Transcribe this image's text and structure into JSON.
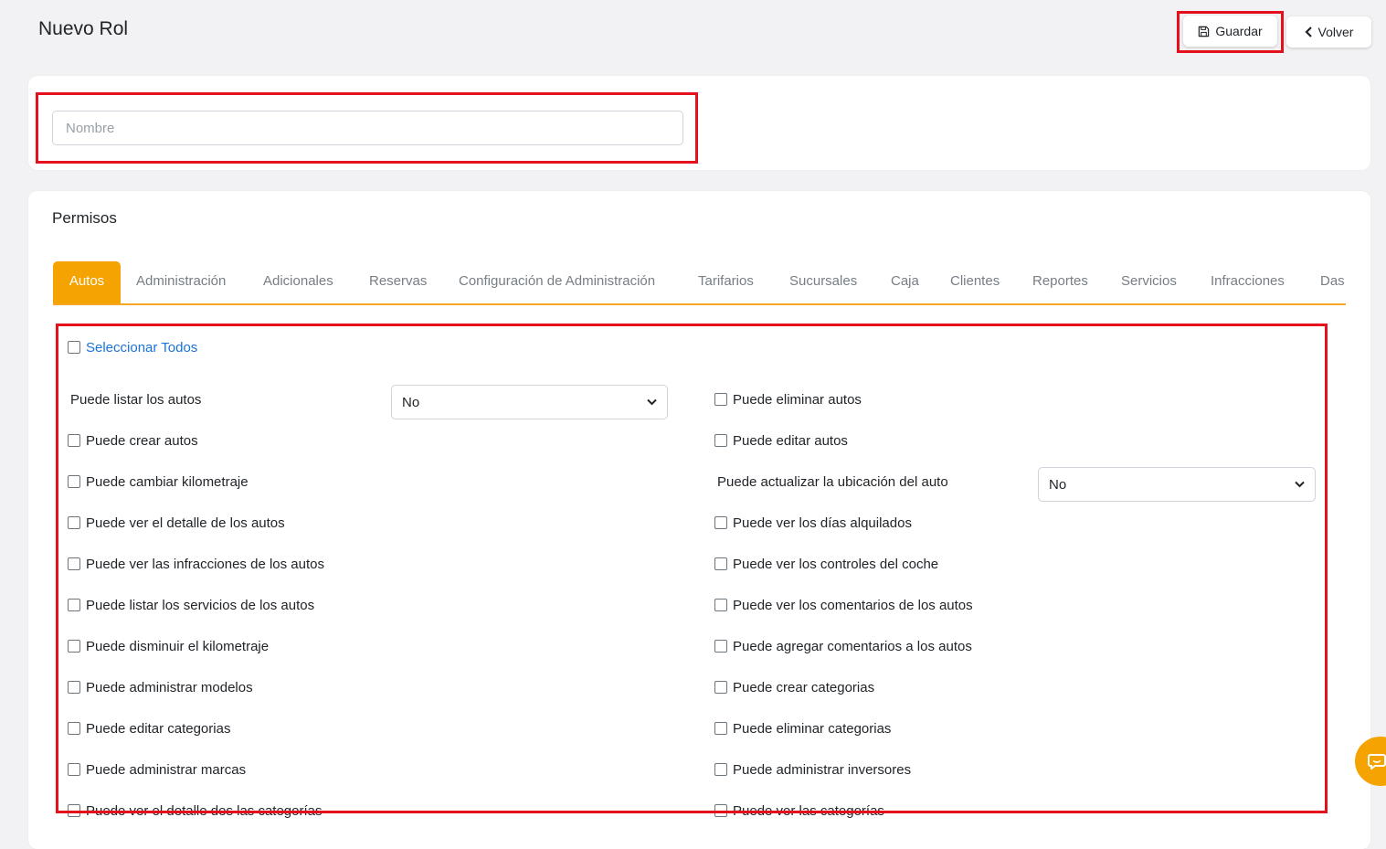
{
  "header": {
    "title": "Nuevo Rol",
    "save_label": "Guardar",
    "back_label": "Volver"
  },
  "form": {
    "name_placeholder": "Nombre",
    "name_value": ""
  },
  "permissions": {
    "title": "Permisos",
    "tabs": [
      "Autos",
      "Administración",
      "Adicionales",
      "Reservas",
      "Configuración de Administración",
      "Tarifarios",
      "Sucursales",
      "Caja",
      "Clientes",
      "Reportes",
      "Servicios",
      "Infracciones",
      "Das"
    ],
    "active_tab": "Autos",
    "select_all_label": "Seleccionar Todos",
    "left": [
      {
        "label": "Puede listar los autos",
        "type": "select",
        "value": "No"
      },
      {
        "label": "Puede crear autos",
        "type": "checkbox",
        "checked": false
      },
      {
        "label": "Puede cambiar kilometraje",
        "type": "checkbox",
        "checked": false
      },
      {
        "label": "Puede ver el detalle de los autos",
        "type": "checkbox",
        "checked": false
      },
      {
        "label": "Puede ver las infracciones de los autos",
        "type": "checkbox",
        "checked": false
      },
      {
        "label": "Puede listar los servicios de los autos",
        "type": "checkbox",
        "checked": false
      },
      {
        "label": "Puede disminuir el kilometraje",
        "type": "checkbox",
        "checked": false
      },
      {
        "label": "Puede administrar modelos",
        "type": "checkbox",
        "checked": false
      },
      {
        "label": "Puede editar categorias",
        "type": "checkbox",
        "checked": false
      },
      {
        "label": "Puede administrar marcas",
        "type": "checkbox",
        "checked": false
      },
      {
        "label": "Puede ver el detalle des las categorías",
        "type": "checkbox",
        "checked": false
      }
    ],
    "right": [
      {
        "label": "Puede eliminar autos",
        "type": "checkbox",
        "checked": false
      },
      {
        "label": "Puede editar autos",
        "type": "checkbox",
        "checked": false
      },
      {
        "label": "Puede actualizar la ubicación del auto",
        "type": "select",
        "value": "No"
      },
      {
        "label": "Puede ver los días alquilados",
        "type": "checkbox",
        "checked": false
      },
      {
        "label": "Puede ver los controles del coche",
        "type": "checkbox",
        "checked": false
      },
      {
        "label": "Puede ver los comentarios de los autos",
        "type": "checkbox",
        "checked": false
      },
      {
        "label": "Puede agregar comentarios a los autos",
        "type": "checkbox",
        "checked": false
      },
      {
        "label": "Puede crear categorias",
        "type": "checkbox",
        "checked": false
      },
      {
        "label": "Puede eliminar categorias",
        "type": "checkbox",
        "checked": false
      },
      {
        "label": "Puede administrar inversores",
        "type": "checkbox",
        "checked": false
      },
      {
        "label": "Puede ver las categorías",
        "type": "checkbox",
        "checked": false
      }
    ]
  },
  "colors": {
    "accent": "#f5a300",
    "highlight": "#e4111c",
    "link": "#1a73d6"
  },
  "icons": {
    "save": "floppy-disk-icon",
    "back": "chevron-left-icon",
    "chat": "chat-bubble-icon"
  }
}
